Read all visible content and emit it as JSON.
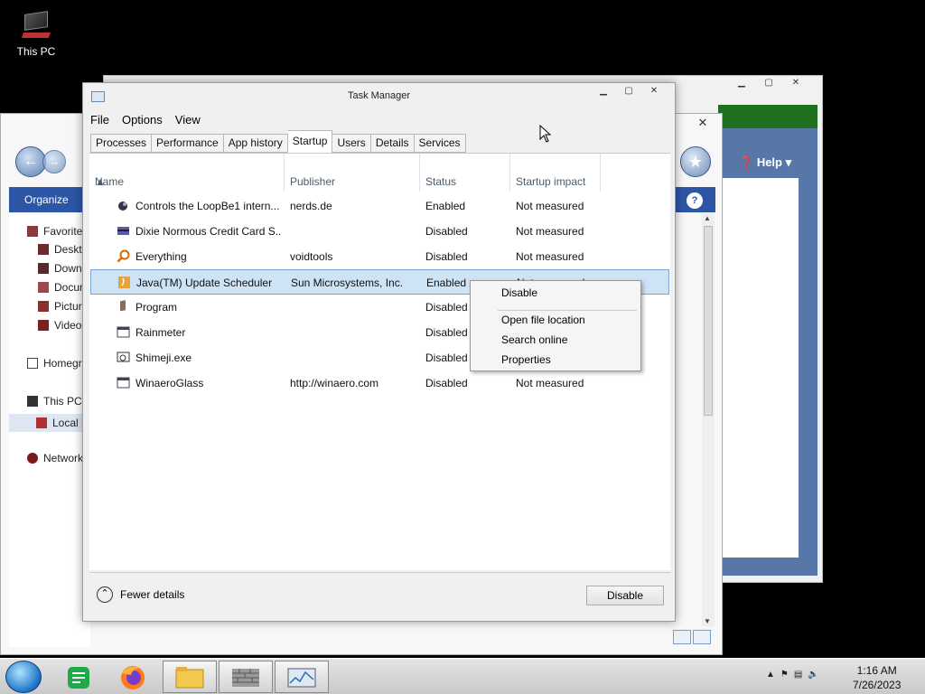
{
  "desktop": {
    "icon_label": "This PC"
  },
  "back_window": {
    "help_label": "Help"
  },
  "explorer": {
    "organize_label": "Organize",
    "tree": [
      "Favorites",
      "Deskto",
      "Downl",
      "Docum",
      "Picture",
      "Videos",
      "Homegr",
      "This PC",
      "Local D",
      "Network"
    ]
  },
  "task_manager": {
    "title": "Task Manager",
    "menu": [
      "File",
      "Options",
      "View"
    ],
    "tabs": [
      "Processes",
      "Performance",
      "App history",
      "Startup",
      "Users",
      "Details",
      "Services"
    ],
    "active_tab": "Startup",
    "columns": [
      "Name",
      "Publisher",
      "Status",
      "Startup impact"
    ],
    "rows": [
      {
        "name": "Controls the LoopBe1 intern...",
        "publisher": "nerds.de",
        "status": "Enabled",
        "impact": "Not measured",
        "icon": "loopbe-icon"
      },
      {
        "name": "Dixie Normous Credit Card S...",
        "publisher": "",
        "status": "Disabled",
        "impact": "Not measured",
        "icon": "credit-card-icon"
      },
      {
        "name": "Everything",
        "publisher": "voidtools",
        "status": "Disabled",
        "impact": "Not measured",
        "icon": "magnifier-icon"
      },
      {
        "name": "Java(TM) Update Scheduler",
        "publisher": "Sun Microsystems, Inc.",
        "status": "Enabled",
        "impact": "Not measured",
        "icon": "java-icon"
      },
      {
        "name": "Program",
        "publisher": "",
        "status": "Disabled",
        "impact": "",
        "icon": "program-icon"
      },
      {
        "name": "Rainmeter",
        "publisher": "",
        "status": "Disabled",
        "impact": "",
        "icon": "window-icon"
      },
      {
        "name": "Shimeji.exe",
        "publisher": "",
        "status": "Disabled",
        "impact": "",
        "icon": "shimeji-icon"
      },
      {
        "name": "WinaeroGlass",
        "publisher": "http://winaero.com",
        "status": "Disabled",
        "impact": "Not measured",
        "icon": "window-icon"
      }
    ],
    "selected_row": 3,
    "context_menu": [
      "Disable",
      "Open file location",
      "Search online",
      "Properties"
    ],
    "footer": {
      "fewer_details": "Fewer details",
      "disable_button": "Disable"
    }
  },
  "taskbar": {
    "clock_time": "1:16 AM",
    "clock_date": "7/26/2023"
  }
}
